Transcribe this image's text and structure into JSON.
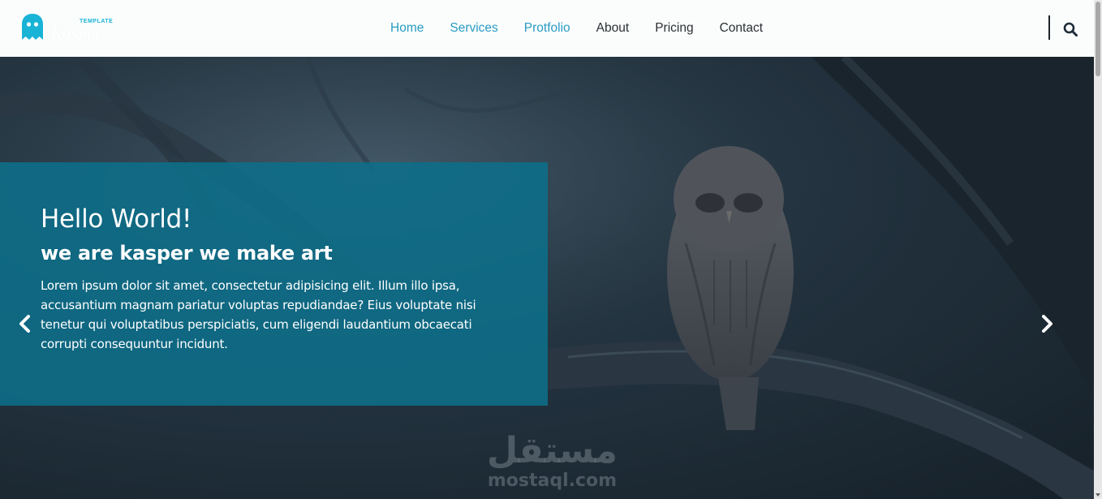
{
  "brand": {
    "tagline": "TEMPLATE",
    "name": "Kasper",
    "accent_color": "#19b3d6"
  },
  "nav": {
    "items": [
      {
        "label": "Home",
        "active": true
      },
      {
        "label": "Services",
        "active": true
      },
      {
        "label": "Protfolio",
        "active": true
      },
      {
        "label": "About",
        "active": false
      },
      {
        "label": "Pricing",
        "active": false
      },
      {
        "label": "Contact",
        "active": false
      }
    ],
    "search_icon": "search-icon"
  },
  "hero": {
    "title": "Hello World!",
    "subtitle": "we are kasper we make art",
    "text": "Lorem ipsum dolor sit amet, consectetur adipisicing elit. Illum illo ipsa, accusantium magnam pariatur voluptas repudiandae? Eius voluptate nisi tenetur qui voluptatibus perspiciatis, cum eligendi laudantium obcaecati corrupti consequuntur incidunt.",
    "caption_color": "#0c6e8a",
    "prev_icon": "chevron-left-icon",
    "next_icon": "chevron-right-icon"
  },
  "watermark": {
    "arabic": "مستقل",
    "latin": "mostaql.com"
  }
}
